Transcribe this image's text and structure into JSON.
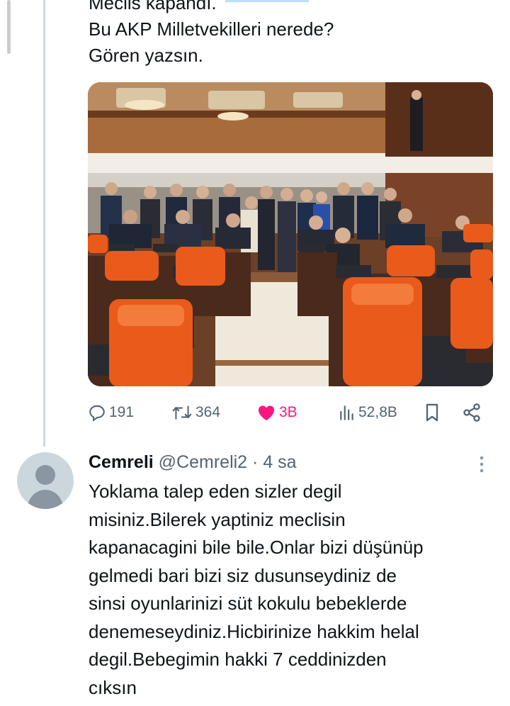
{
  "tweet": {
    "text_lines": [
      "Meclis kapandı.",
      "Bu AKP Milletvekilleri nerede?",
      "Gören yazsın."
    ],
    "stats": {
      "replies": "191",
      "retweets": "364",
      "likes": "3B",
      "views": "52,8B"
    }
  },
  "reply": {
    "name": "Cemreli",
    "handle": "@Cemreli2",
    "separator": "·",
    "time": "4 sa",
    "text_lines": [
      "Yoklama talep eden sizler degil",
      "misiniz.Bilerek yaptiniz meclisin",
      "kapanacagini bile bile.Onlar bizi düşünüp",
      "gelmedi bari bizi siz dusunseydiniz de",
      "sinsi oyunlarinizi süt kokulu bebeklerde",
      "denemeseydiniz.Hicbirinize hakkim helal",
      "degil.Bebegimin hakki 7 ceddinizden",
      "cıksın"
    ]
  },
  "icons": {
    "reply": "reply-icon",
    "retweet": "retweet-icon",
    "like": "heart-icon",
    "views": "views-icon",
    "bookmark": "bookmark-icon",
    "share": "share-icon",
    "more": "more-icon"
  },
  "colors": {
    "like_active": "#f91880",
    "secondary_text": "#536471",
    "thread_line": "#cfd9de"
  }
}
